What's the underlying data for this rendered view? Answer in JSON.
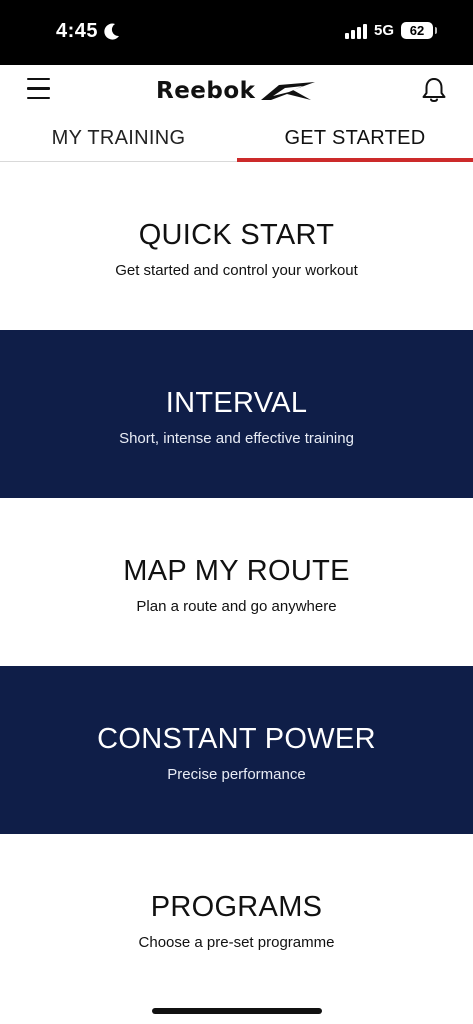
{
  "status_bar": {
    "time": "4:45",
    "network": "5G",
    "battery": "62"
  },
  "header": {
    "logo_text": "Reebok"
  },
  "tabs": [
    {
      "label": "MY TRAINING",
      "active": false
    },
    {
      "label": "GET STARTED",
      "active": true
    }
  ],
  "cards": [
    {
      "title": "QUICK START",
      "subtitle": "Get started and control your workout",
      "theme": "light"
    },
    {
      "title": "INTERVAL",
      "subtitle": "Short, intense and effective training",
      "theme": "dark"
    },
    {
      "title": "MAP MY ROUTE",
      "subtitle": "Plan a route and go anywhere",
      "theme": "light"
    },
    {
      "title": "CONSTANT POWER",
      "subtitle": "Precise performance",
      "theme": "dark"
    },
    {
      "title": "PROGRAMS",
      "subtitle": "Choose a pre-set programme",
      "theme": "light"
    }
  ],
  "colors": {
    "navy": "#0f1e48",
    "accent_red": "#cc2a2a"
  }
}
